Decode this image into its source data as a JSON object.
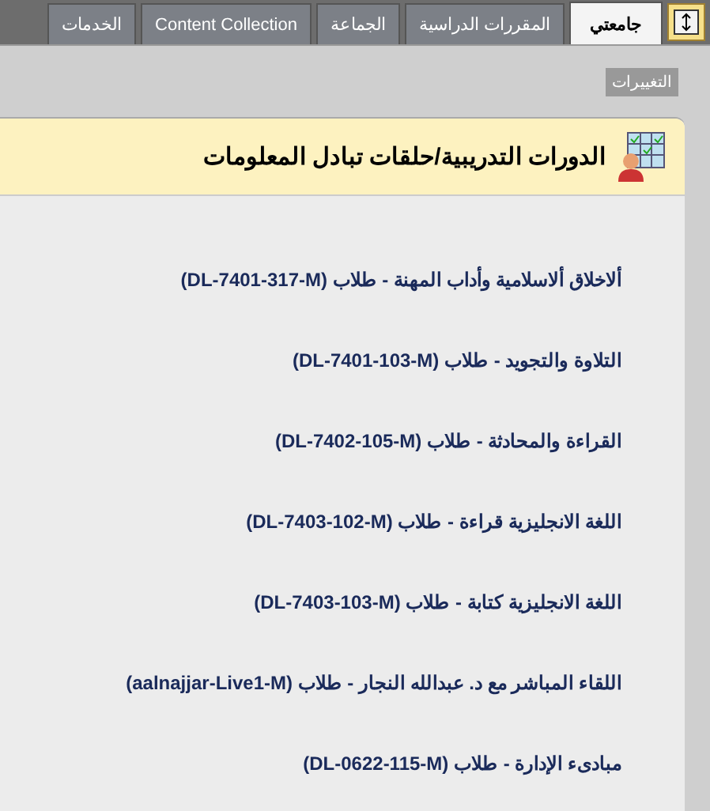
{
  "tabs": [
    {
      "label": "جامعتي",
      "selected": true
    },
    {
      "label": "المقررات الدراسية",
      "selected": false
    },
    {
      "label": "الجماعة",
      "selected": false
    },
    {
      "label": "Content Collection",
      "selected": false
    },
    {
      "label": "الخدمات",
      "selected": false
    }
  ],
  "changes_button": "التغييرات",
  "module": {
    "title": "الدورات التدريبية/حلقات تبادل المعلومات",
    "courses": [
      "ألاخلاق ألاسلامية وأداب المهنة - طلاب (DL-7401-317-M)",
      "التلاوة والتجويد - طلاب (DL-7401-103-M)",
      "القراءة والمحادثة - طلاب (DL-7402-105-M)",
      "اللغة الانجليزية قراءة - طلاب (DL-7403-102-M)",
      "اللغة الانجليزية كتابة - طلاب (DL-7403-103-M)",
      "اللقاء المباشر مع د. عبدالله النجار - طلاب (aalnajjar-Live1-M)",
      "مبادىء الإدارة - طلاب (DL-0622-115-M)"
    ]
  }
}
